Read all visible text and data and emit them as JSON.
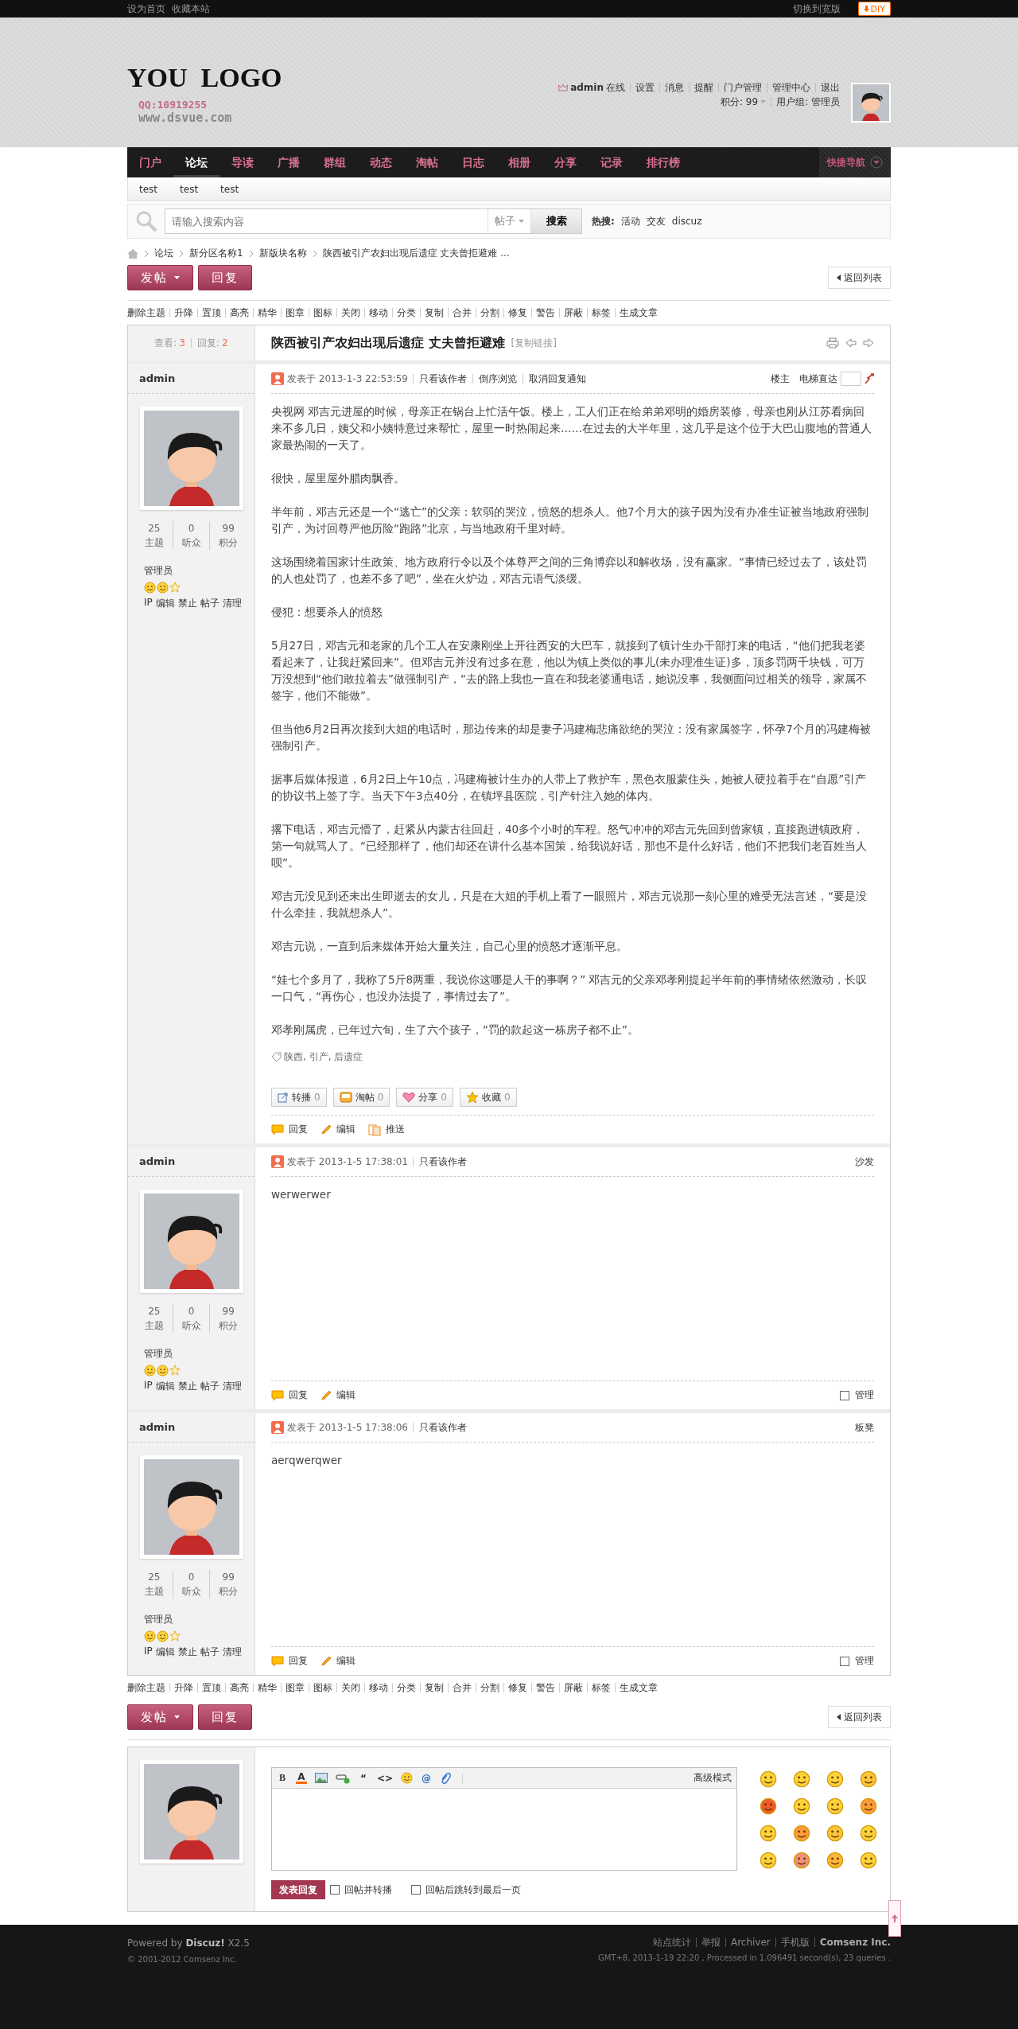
{
  "top_bar": {
    "links": [
      "设为首页",
      "收藏本站"
    ],
    "switch_width": "切换到宽版",
    "diy_button": "DIY"
  },
  "header": {
    "logo": "YOU  LOGO",
    "qq": "QQ:10919255",
    "site": "www.dsvue.com",
    "user": {
      "name": "admin",
      "status": "在线",
      "links": [
        "设置",
        "消息",
        "提醒",
        "门户管理",
        "管理中心",
        "退出"
      ],
      "points": "积分: 99",
      "group": "用户组: 管理员"
    }
  },
  "nav": {
    "items": [
      {
        "label": "门户",
        "selected": false
      },
      {
        "label": "论坛",
        "selected": true
      },
      {
        "label": "导读",
        "selected": false
      },
      {
        "label": "广播",
        "selected": false
      },
      {
        "label": "群组",
        "selected": false
      },
      {
        "label": "动态",
        "selected": false
      },
      {
        "label": "淘帖",
        "selected": false
      },
      {
        "label": "日志",
        "selected": false
      },
      {
        "label": "相册",
        "selected": false
      },
      {
        "label": "分享",
        "selected": false
      },
      {
        "label": "记录",
        "selected": false
      },
      {
        "label": "排行榜",
        "selected": false
      }
    ],
    "quick_nav": "快捷导航"
  },
  "sub_nav": [
    "test",
    "test",
    "test"
  ],
  "search": {
    "placeholder": "请输入搜索内容",
    "scope": "帖子",
    "button": "搜索",
    "hot_label": "热搜:",
    "hot": [
      "活动",
      "交友",
      "discuz"
    ]
  },
  "breadcrumb": [
    "论坛",
    "新分区名称1",
    "新版块名称",
    "陕西被引产农妇出现后遗症 丈夫曾拒避难 ..."
  ],
  "action_bars": [
    {
      "post_button": "发帖",
      "reply_button": "回复",
      "back": "返回列表"
    },
    {
      "post_button": "发帖",
      "reply_button": "回复",
      "back": "返回列表"
    }
  ],
  "mod_bars": [
    [
      "删除主题",
      "升降",
      "置顶",
      "高亮",
      "精华",
      "图章",
      "图标",
      "关闭",
      "移动",
      "分类",
      "复制",
      "合并",
      "分割",
      "修复",
      "警告",
      "屏蔽",
      "标签",
      "生成文章"
    ],
    [
      "删除主题",
      "升降",
      "置顶",
      "高亮",
      "精华",
      "图章",
      "图标",
      "关闭",
      "移动",
      "分类",
      "复制",
      "合并",
      "分割",
      "修复",
      "警告",
      "屏蔽",
      "标签",
      "生成文章"
    ]
  ],
  "thread": {
    "views_label": "查看:",
    "views": "3",
    "replies_label": "回复:",
    "replies": "2",
    "title": "陕西被引产农妇出现后遗症 丈夫曾拒避难",
    "copy_link": "[复制链接]"
  },
  "posts": [
    {
      "author": "admin",
      "stats": [
        {
          "value": "25",
          "label": "主题"
        },
        {
          "value": "0",
          "label": "听众"
        },
        {
          "value": "99",
          "label": "积分"
        }
      ],
      "group": "管理员",
      "admin_links": [
        "IP",
        "编辑",
        "禁止",
        "帖子",
        "清理"
      ],
      "posted": "发表于 2013-1-3 22:53:59",
      "meta_links": [
        "只看该作者",
        "倒序浏览",
        "取消回复通知"
      ],
      "floor": "楼主",
      "jump_label": "电梯直达",
      "paragraphs": [
        "央视网 邓吉元进屋的时候，母亲正在锅台上忙活午饭。楼上，工人们正在给弟弟邓明的婚房装修，母亲也刚从江苏看病回来不多几日，姨父和小姨特意过来帮忙，屋里一时热闹起来……在过去的大半年里，这几乎是这个位于大巴山腹地的普通人家最热闹的一天了。",
        "很快，屋里屋外腊肉飘香。",
        "半年前，邓吉元还是一个“逃亡”的父亲：软弱的哭泣，愤怒的想杀人。他7个月大的孩子因为没有办准生证被当地政府强制引产，为讨回尊严他历险“跑路”北京，与当地政府千里对峙。",
        "这场围绕着国家计生政策、地方政府行令以及个体尊严之间的三角博弈以和解收场，没有赢家。“事情已经过去了，该处罚的人也处罚了，也差不多了吧”，坐在火炉边，邓吉元语气淡缓。",
        "侵犯：想要杀人的愤怒",
        "5月27日，邓吉元和老家的几个工人在安康刚坐上开往西安的大巴车，就接到了镇计生办干部打来的电话，“他们把我老婆看起来了，让我赶紧回来”。但邓吉元并没有过多在意，他以为镇上类似的事儿(未办理准生证)多，顶多罚两千块钱，可万万没想到“他们敢拉着去”做强制引产，“去的路上我也一直在和我老婆通电话，她说没事，我侧面问过相关的领导，家属不签字，他们不能做”。",
        "但当他6月2日再次接到大姐的电话时，那边传来的却是妻子冯建梅悲痛欲绝的哭泣：没有家属签字，怀孕7个月的冯建梅被强制引产。",
        "据事后媒体报道，6月2日上午10点，冯建梅被计生办的人带上了救护车，黑色衣服蒙住头，她被人硬拉着手在“自愿”引产的协议书上签了字。当天下午3点40分，在镇坪县医院，引产针注入她的体内。",
        "撂下电话，邓吉元懵了，赶紧从内蒙古往回赶，40多个小时的车程。怒气冲冲的邓吉元先回到曾家镇，直接跑进镇政府，第一句就骂人了。“已经那样了，他们却还在讲什么基本国策，给我说好话，那也不是什么好话，他们不把我们老百姓当人呗”。",
        "邓吉元没见到还未出生即逝去的女儿，只是在大姐的手机上看了一眼照片，邓吉元说那一刻心里的难受无法言述，“要是没什么牵挂，我就想杀人”。",
        "邓吉元说，一直到后来媒体开始大量关注，自己心里的愤怒才逐渐平息。",
        "“娃七个多月了，我称了5斤8两重，我说你这哪是人干的事啊？” 邓吉元的父亲邓孝刚提起半年前的事情绪依然激动，长叹一口气，“再伤心，也没办法提了，事情过去了”。",
        "邓孝刚属虎，已年过六旬，生了六个孩子，“罚的款起这一栋房子都不止”。"
      ],
      "tags": "陕西, 引产, 后遗症",
      "share": [
        {
          "kind": "relay",
          "label": "转播",
          "count": "0"
        },
        {
          "kind": "collect",
          "label": "淘帖",
          "count": "0"
        },
        {
          "kind": "share",
          "label": "分享",
          "count": "0"
        },
        {
          "kind": "favorite",
          "label": "收藏",
          "count": "0"
        }
      ],
      "actions": [
        {
          "kind": "reply",
          "label": "回复"
        },
        {
          "kind": "edit",
          "label": "编辑"
        },
        {
          "kind": "push",
          "label": "推送"
        }
      ]
    },
    {
      "author": "admin",
      "stats": [
        {
          "value": "25",
          "label": "主题"
        },
        {
          "value": "0",
          "label": "听众"
        },
        {
          "value": "99",
          "label": "积分"
        }
      ],
      "group": "管理员",
      "admin_links": [
        "IP",
        "编辑",
        "禁止",
        "帖子",
        "清理"
      ],
      "posted": "发表于 2013-1-5 17:38:01",
      "meta_links": [
        "只看该作者"
      ],
      "floor": "沙发",
      "paragraphs": [
        "werwerwer"
      ],
      "actions": [
        {
          "kind": "reply",
          "label": "回复"
        },
        {
          "kind": "edit",
          "label": "编辑"
        }
      ],
      "manage": {
        "label": "管理",
        "checked": false
      }
    },
    {
      "author": "admin",
      "stats": [
        {
          "value": "25",
          "label": "主题"
        },
        {
          "value": "0",
          "label": "听众"
        },
        {
          "value": "99",
          "label": "积分"
        }
      ],
      "group": "管理员",
      "admin_links": [
        "IP",
        "编辑",
        "禁止",
        "帖子",
        "清理"
      ],
      "posted": "发表于 2013-1-5 17:38:06",
      "meta_links": [
        "只看该作者"
      ],
      "floor": "板凳",
      "paragraphs": [
        "aerqwerqwer"
      ],
      "actions": [
        {
          "kind": "reply",
          "label": "回复"
        },
        {
          "kind": "edit",
          "label": "编辑"
        }
      ],
      "manage": {
        "label": "管理",
        "checked": false
      }
    }
  ],
  "reply_box": {
    "tools": [
      {
        "kind": "bold",
        "label": "B"
      },
      {
        "kind": "color",
        "label": "A"
      },
      {
        "kind": "image"
      },
      {
        "kind": "link"
      },
      {
        "kind": "quote",
        "label": "“"
      },
      {
        "kind": "code",
        "label": "<>"
      },
      {
        "kind": "smiley"
      },
      {
        "kind": "at",
        "label": "@"
      },
      {
        "kind": "attach"
      }
    ],
    "mode": "高级模式",
    "submit": "发表回复",
    "options": [
      {
        "label": "回帖并转播",
        "checked": false
      },
      {
        "label": "回帖后跳转到最后一页",
        "checked": false
      }
    ]
  },
  "footer": {
    "powered": "Powered by **Discuz!** X2.5",
    "copyright": "© 2001-2012 Comsenz Inc.",
    "links": [
      "站点统计",
      "举报",
      "Archiver",
      "手机版"
    ],
    "company": "Comsenz Inc.",
    "stats": "GMT+8, 2013-1-19 22:20 , Processed in 1.096491 second(s), 23 queries ."
  }
}
